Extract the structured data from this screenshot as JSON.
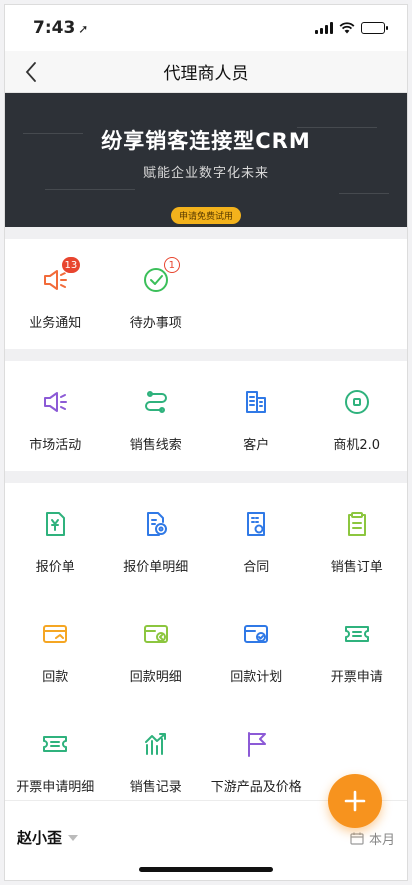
{
  "status_bar": {
    "time": "7:43"
  },
  "navbar": {
    "title": "代理商人员"
  },
  "banner": {
    "headline": "纷享销客连接型CRM",
    "subline": "赋能企业数字化未来",
    "cta": "申请免费试用"
  },
  "notify_section": {
    "items": [
      {
        "label": "业务通知",
        "icon": "megaphone-icon",
        "badge": "13",
        "color": "#f26b3a"
      },
      {
        "label": "待办事项",
        "icon": "check-circle-icon",
        "badge": "1",
        "color": "#3bbf5a"
      }
    ]
  },
  "crm_section": {
    "items": [
      {
        "label": "市场活动",
        "icon": "megaphone-icon",
        "color": "#8c5ad6"
      },
      {
        "label": "销售线索",
        "icon": "leads-icon",
        "color": "#2fb27d"
      },
      {
        "label": "客户",
        "icon": "building-icon",
        "color": "#3079e6"
      },
      {
        "label": "商机2.0",
        "icon": "target-icon",
        "color": "#2fb27d"
      }
    ]
  },
  "trade_section": {
    "items": [
      {
        "label": "报价单",
        "icon": "yen-doc-icon",
        "color": "#2fb27d"
      },
      {
        "label": "报价单明细",
        "icon": "doc-gear-icon",
        "color": "#3079e6"
      },
      {
        "label": "合同",
        "icon": "contract-icon",
        "color": "#3079e6"
      },
      {
        "label": "销售订单",
        "icon": "clipboard-icon",
        "color": "#8cc63f"
      },
      {
        "label": "回款",
        "icon": "card-hand-icon",
        "color": "#f5a623"
      },
      {
        "label": "回款明细",
        "icon": "card-arrow-icon",
        "color": "#8cc63f"
      },
      {
        "label": "回款计划",
        "icon": "card-check-icon",
        "color": "#3079e6"
      },
      {
        "label": "开票申请",
        "icon": "ticket-icon",
        "color": "#2fb27d"
      },
      {
        "label": "开票申请明细",
        "icon": "ticket-icon",
        "color": "#2fb27d"
      },
      {
        "label": "销售记录",
        "icon": "chart-up-icon",
        "color": "#2fb27d"
      },
      {
        "label": "下游产品及价格",
        "icon": "flag-icon",
        "color": "#8c5ad6"
      }
    ]
  },
  "footer": {
    "user": "赵小歪",
    "period": "本月"
  },
  "fab": {
    "icon": "plus-icon",
    "color": "#f7931e"
  }
}
